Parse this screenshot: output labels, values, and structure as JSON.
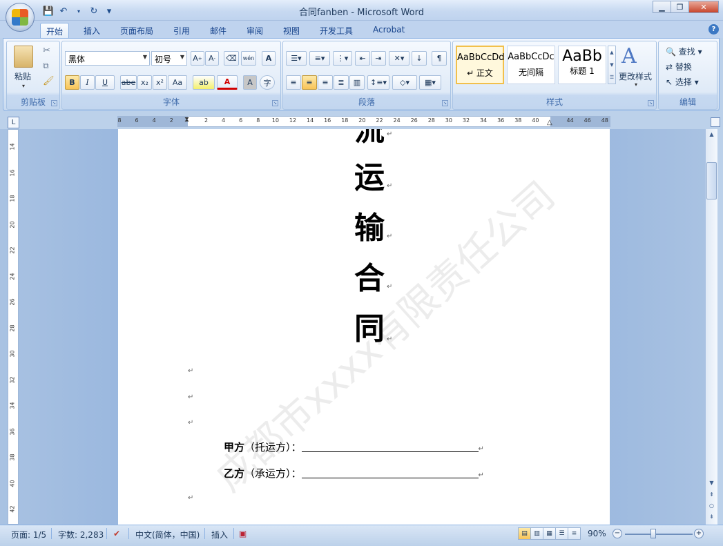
{
  "window": {
    "title": "合同fanben - Microsoft Word"
  },
  "qat": {
    "save": "💾",
    "undo": "↶",
    "redo": "↻",
    "customize": "▾"
  },
  "tabs": [
    "开始",
    "插入",
    "页面布局",
    "引用",
    "邮件",
    "审阅",
    "视图",
    "开发工具",
    "Acrobat"
  ],
  "ribbon": {
    "clipboard": {
      "label": "剪贴板",
      "paste": "粘贴"
    },
    "font": {
      "label": "字体",
      "font_name": "黑体",
      "font_size": "初号",
      "wen": "wén",
      "bold": "B",
      "italic": "I",
      "underline": "U",
      "strike": "abe",
      "sub": "x₂",
      "sup": "x²",
      "case": "Aa",
      "font_color": "A",
      "char_shade": "A",
      "enclose": "字"
    },
    "paragraph": {
      "label": "段落"
    },
    "styles": {
      "label": "样式",
      "items": [
        {
          "sample": "AaBbCcDd",
          "name": "↵ 正文"
        },
        {
          "sample": "AaBbCcDc",
          "name": "无间隔"
        },
        {
          "sample": "AaBb",
          "name": "标题 1"
        }
      ],
      "change": "更改样式"
    },
    "editing": {
      "label": "编辑",
      "find": "查找",
      "replace": "替换",
      "select": "选择"
    }
  },
  "ruler": {
    "numbers": [
      "8",
      "6",
      "4",
      "2",
      "",
      "2",
      "4",
      "6",
      "8",
      "10",
      "12",
      "14",
      "16",
      "18",
      "20",
      "22",
      "24",
      "26",
      "28",
      "30",
      "32",
      "34",
      "36",
      "38",
      "40",
      "",
      "44",
      "46",
      "48"
    ]
  },
  "vruler": {
    "numbers": [
      "14",
      "16",
      "18",
      "20",
      "22",
      "24",
      "26",
      "28",
      "30",
      "32",
      "34",
      "36",
      "38",
      "40",
      "42"
    ]
  },
  "document": {
    "title_chars": [
      "流",
      "运",
      "输",
      "合",
      "同"
    ],
    "watermark": "成都市xxxx有限责任公司",
    "party_a_label": "甲方",
    "party_a_role": "（托运方）：",
    "party_b_label": "乙方",
    "party_b_role": "（承运方）：",
    "para_mark": "↵"
  },
  "status": {
    "page": "页面: 1/5",
    "words": "字数: 2,283",
    "language": "中文(简体，中国)",
    "mode": "插入",
    "zoom": "90%"
  }
}
